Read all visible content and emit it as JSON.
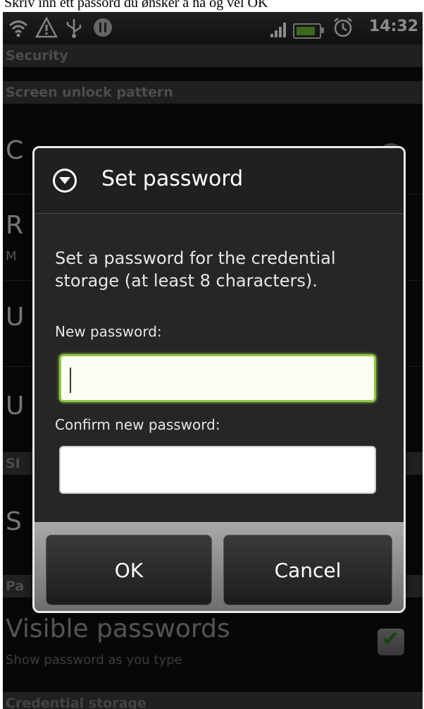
{
  "caption": {
    "text": "Skriv inn ett passord du ønsker å ha og vel OK"
  },
  "status_bar": {
    "time": "14:32",
    "icons": [
      "wifi-icon",
      "warning-icon",
      "usb-icon",
      "notification-icon",
      "signal-icon",
      "battery-icon",
      "alarm-icon"
    ]
  },
  "screen": {
    "header": "Security"
  },
  "sections": {
    "unlock": "Screen unlock pattern",
    "sim": "SI",
    "passwords": "Pa",
    "credential": "Credential storage"
  },
  "rows": {
    "change_pattern_peek": "C",
    "require_pattern_peek": "R",
    "require_pattern_sub_peek": "M",
    "use_visible_peek": "U",
    "use_tactile_peek": "U",
    "sim_lock_peek": "S",
    "visible_passwords": {
      "title": "Visible passwords",
      "subtitle": "Show password as you type",
      "checked": true
    }
  },
  "dialog": {
    "title": "Set password",
    "message": "Set a password for the credential storage (at least 8 characters).",
    "new_password_label": "New password:",
    "confirm_password_label": "Confirm new password:",
    "new_password_value": "",
    "confirm_password_value": "",
    "ok_label": "OK",
    "cancel_label": "Cancel"
  },
  "colors": {
    "accent_focus": "#8dc63f",
    "check_green": "#3faa2a"
  }
}
